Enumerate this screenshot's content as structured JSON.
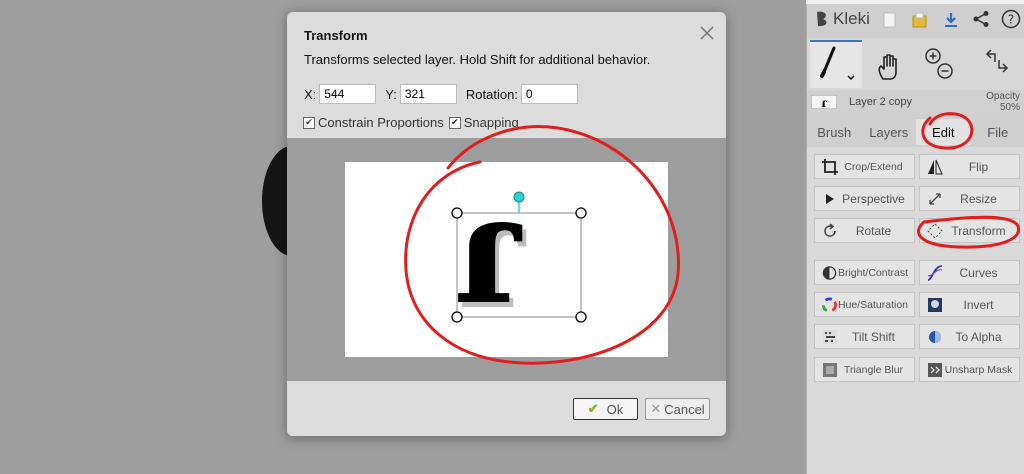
{
  "dialog": {
    "title": "Transform",
    "description": "Transforms selected layer. Hold Shift for additional behavior.",
    "x_label": "X:",
    "x_value": "544",
    "y_label": "Y:",
    "y_value": "321",
    "rotation_label": "Rotation:",
    "rotation_value": "0",
    "constrain_label": "Constrain Proportions",
    "constrain_checked": true,
    "snapping_label": "Snapping",
    "snapping_checked": true,
    "ok_label": "Ok",
    "cancel_label": "Cancel",
    "preview_glyph": "ɾ"
  },
  "sidebar": {
    "app_name": "Kleki",
    "layer_name": "Layer 2 copy",
    "opacity_label": "Opacity",
    "opacity_value": "50%",
    "tabs": [
      "Brush",
      "Layers",
      "Edit",
      "File"
    ],
    "active_tab": "Edit",
    "edit_buttons": [
      "Crop/Extend",
      "Flip",
      "Perspective",
      "Resize",
      "Rotate",
      "Transform",
      "Bright/Contrast",
      "Curves",
      "Hue/Saturation",
      "Invert",
      "Tilt Shift",
      "To Alpha",
      "Triangle Blur",
      "Unsharp Mask"
    ]
  },
  "colors": {
    "accent": "#3576c8",
    "annotation": "#e01e1e",
    "handle": "#29d3d3",
    "ok_check": "#7dbb2b"
  }
}
